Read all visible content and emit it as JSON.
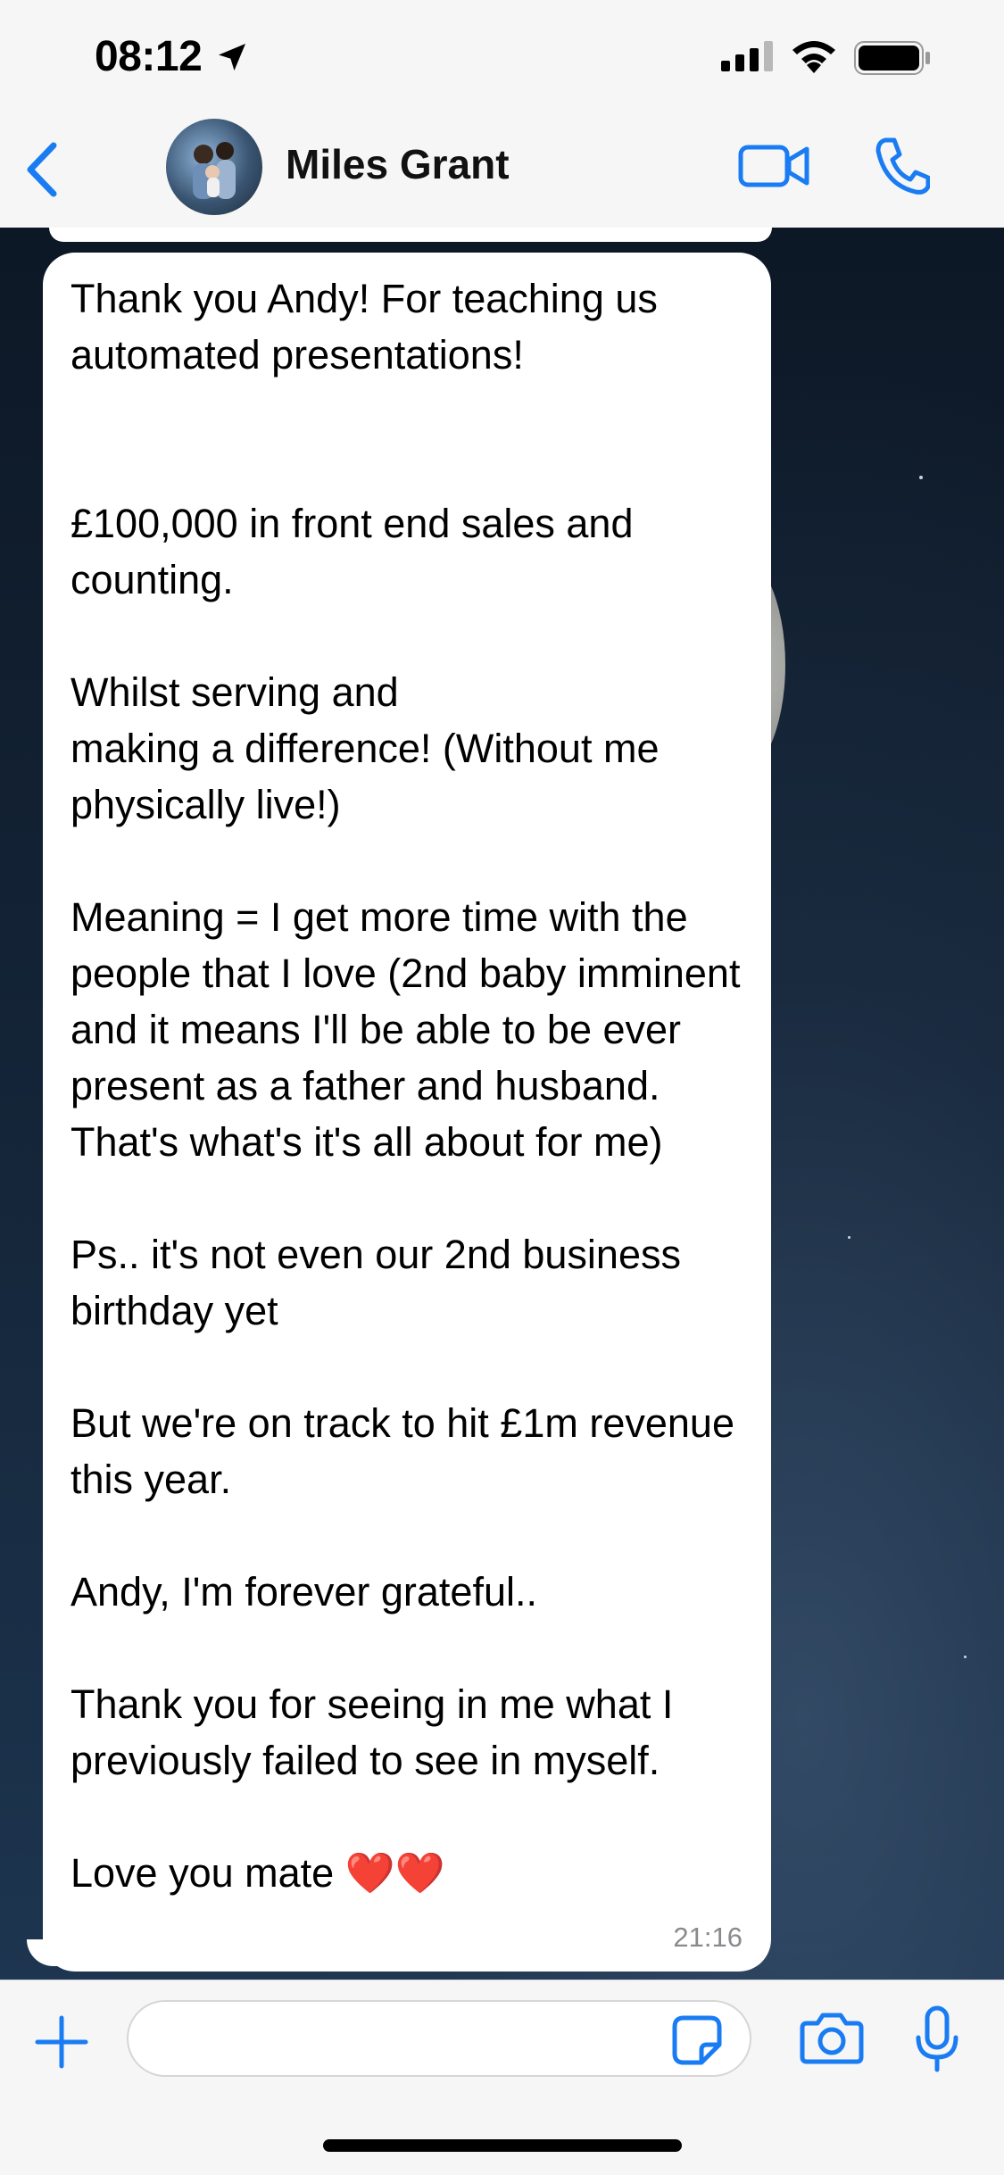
{
  "status_bar": {
    "time": "08:12",
    "icons": [
      "location-arrow-icon",
      "cellular-signal-icon",
      "wifi-icon",
      "battery-icon"
    ]
  },
  "header": {
    "back_icon": "chevron-left-icon",
    "contact_name": "Miles Grant",
    "actions": [
      "video-call-icon",
      "phone-icon"
    ]
  },
  "message": {
    "text": "Thank you Andy! For teaching us automated presentations!\n\n\n£100,000 in front end sales and counting.\n\nWhilst serving and\nmaking a difference! (Without me physically live!)\n\nMeaning = I get more time with the people that I love (2nd baby imminent and it means I'll be able to be ever present as a father and husband. That's what's it's all about for me)\n\nPs.. it's not even our 2nd business birthday yet\n\nBut we're on track to hit £1m revenue this year.\n\nAndy, I'm forever grateful..\n\nThank you for seeing in me what I previously failed to see in myself.\n\nLove you mate ",
    "hearts": "❤️❤️",
    "timestamp": "21:16"
  },
  "input_bar": {
    "placeholder": "",
    "icons": [
      "plus-icon",
      "sticker-icon",
      "camera-icon",
      "microphone-icon"
    ]
  },
  "colors": {
    "accent": "#1a7cf2",
    "header_bg": "#f6f6f6",
    "bubble_bg": "#ffffff",
    "timestamp": "#8a8a8e"
  }
}
